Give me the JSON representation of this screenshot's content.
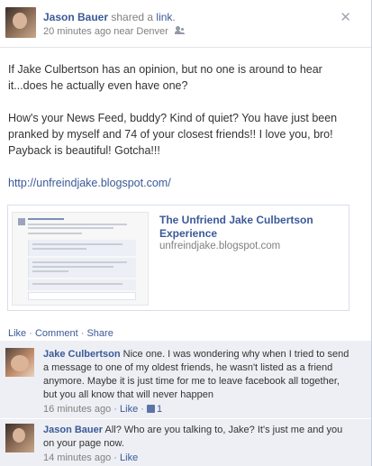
{
  "post": {
    "author": "Jason Bauer",
    "action_text": "shared a",
    "link_word": "link",
    "time": "20 minutes ago",
    "location_prefix": "near",
    "location": "Denver",
    "message_p1": "If Jake Culbertson has an opinion, but no one is around to hear it...does he actually even have one?",
    "message_p2": "How's your News Feed, buddy? Kind of quiet? You have just been pranked by myself and 74 of your closest friends!! I love you, bro! Payback is beautiful! Gotcha!!!",
    "url": "http://unfreindjake.blogspot.com/"
  },
  "shared_link": {
    "title": "The Unfriend Jake Culbertson Experience",
    "domain": "unfreindjake.blogspot.com"
  },
  "actions": {
    "like": "Like",
    "comment": "Comment",
    "share": "Share",
    "separator": "·"
  },
  "comments": [
    {
      "author": "Jake Culbertson",
      "text": "Nice one. I was wondering why when I tried to send a message to one of my oldest friends, he wasn't listed as a friend anymore. Maybe it is just time for me to leave facebook all together, but you all know that will never happen",
      "time": "16 minutes ago",
      "like": "Like",
      "like_count": "1"
    },
    {
      "author": "Jason Bauer",
      "text": "All? Who are you talking to, Jake? It's just me and you on your page now.",
      "time": "14 minutes ago",
      "like": "Like"
    }
  ],
  "colors": {
    "link": "#3b5998",
    "muted": "#808080",
    "comment_bg": "#edeff4"
  },
  "icons": {
    "close": "close-icon",
    "audience": "friends-icon",
    "like": "thumbs-up-icon"
  }
}
